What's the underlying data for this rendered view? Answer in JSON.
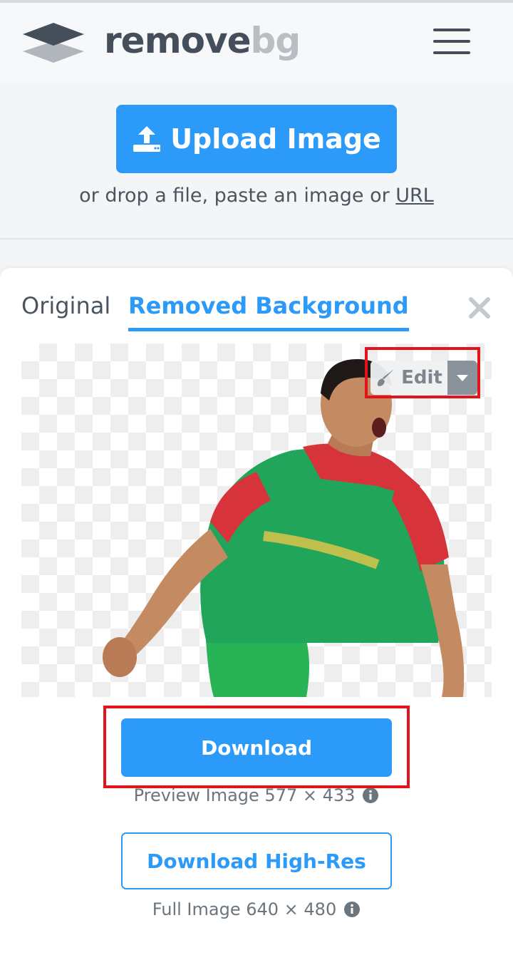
{
  "header": {
    "logo_remove": "remove",
    "logo_bg": "bg",
    "menu_icon": "hamburger-menu-icon"
  },
  "upload": {
    "button_label": "Upload Image",
    "drop_text_prefix": "or drop a file, paste an image or ",
    "url_link": "URL"
  },
  "result": {
    "tabs": [
      {
        "label": "Original",
        "active": false
      },
      {
        "label": "Removed Background",
        "active": true
      }
    ],
    "edit_label": "Edit",
    "download_label": "Download",
    "preview_info": "Preview Image 577 × 433",
    "download_hires_label": "Download High-Res",
    "full_info": "Full Image 640 × 480"
  },
  "colors": {
    "accent": "#2c9af8",
    "highlight": "#e0141a",
    "text": "#454f5b"
  }
}
